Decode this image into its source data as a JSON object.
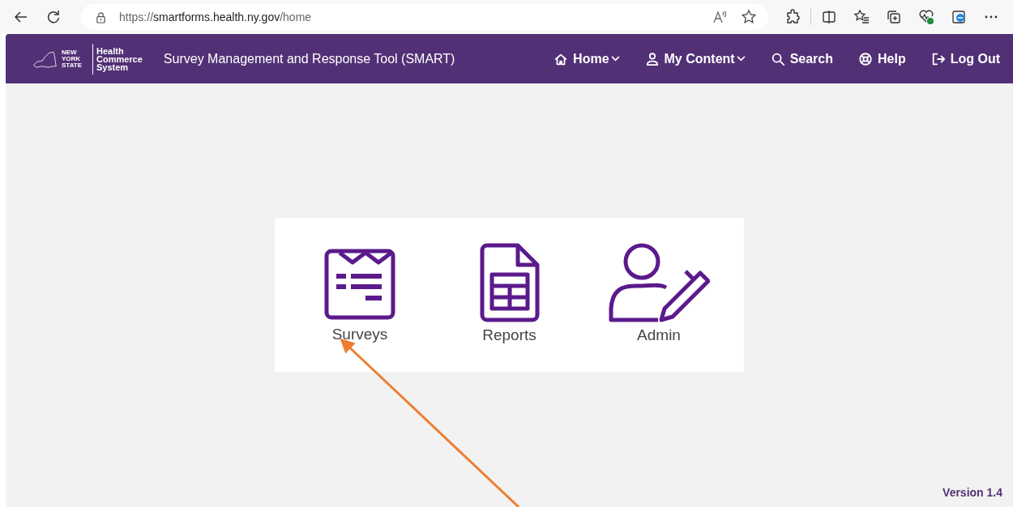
{
  "browser": {
    "url_prefix": "https://",
    "url_host": "smartforms.health.ny.gov",
    "url_path": "/home"
  },
  "header": {
    "logo_state": "NEW YORK STATE",
    "logo_lines": [
      "Health",
      "Commerce",
      "System"
    ],
    "title": "Survey Management and Response Tool (SMART)",
    "nav": [
      {
        "label": "Home",
        "has_menu": true
      },
      {
        "label": "My Content",
        "has_menu": true
      },
      {
        "label": "Search",
        "has_menu": false
      },
      {
        "label": "Help",
        "has_menu": false
      },
      {
        "label": "Log Out",
        "has_menu": false
      }
    ]
  },
  "tiles": [
    {
      "label": "Surveys"
    },
    {
      "label": "Reports"
    },
    {
      "label": "Admin"
    }
  ],
  "version": "Version 1.4"
}
